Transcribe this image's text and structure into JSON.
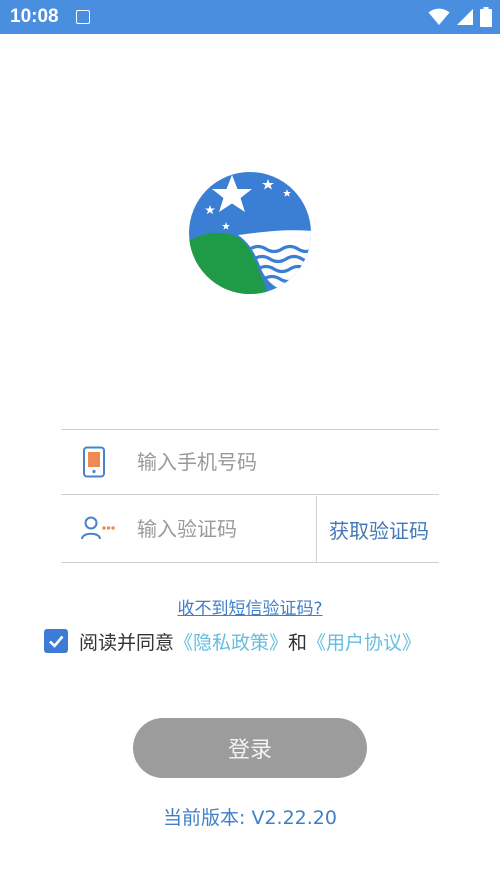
{
  "status_bar": {
    "time": "10:08"
  },
  "login": {
    "phone_placeholder": "输入手机号码",
    "code_placeholder": "输入验证码",
    "get_code_label": "获取验证码",
    "no_sms_link": "收不到短信验证码?",
    "agree_text": "阅读并同意",
    "privacy_link": "《隐私政策》",
    "and_text": "和",
    "user_agreement_link": "《用户协议》",
    "agree_checked": true,
    "login_button": "登录",
    "version": "当前版本: V2.22.20"
  },
  "colors": {
    "status_bar": "#4a8ee0",
    "link_blue": "#3f7fc8",
    "doc_link": "#66bde0",
    "button_disabled": "#9c9c9c",
    "checkbox": "#3d7bd6"
  },
  "icons": {
    "status": [
      "app-notification-icon",
      "wifi-icon",
      "signal-icon",
      "battery-icon"
    ],
    "phone_field": "phone-icon",
    "code_field": "user-code-icon",
    "checkbox": "check-icon"
  }
}
